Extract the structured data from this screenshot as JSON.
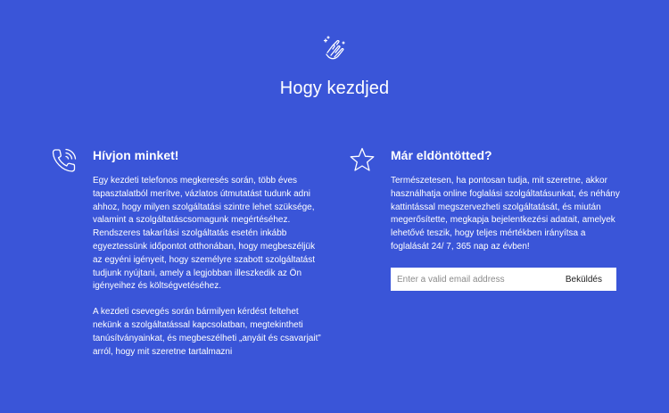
{
  "header": {
    "icon": "hand-wash-icon",
    "title": "Hogy kezdjed"
  },
  "left": {
    "icon": "phone-icon",
    "heading": "Hívjon minket!",
    "paragraphs": [
      "Egy kezdeti telefonos megkeresés során, több éves tapasztalatból merítve, vázlatos útmutatást tudunk adni ahhoz, hogy milyen szolgáltatási szintre lehet szüksége, valamint a szolgáltatáscsomagunk megértéséhez. Rendszeres takarítási szolgáltatás esetén inkább egyeztessünk időpontot otthonában, hogy megbeszéljük az egyéni igényeit, hogy személyre szabott szolgáltatást tudjunk nyújtani, amely a legjobban illeszkedik az Ön igényeihez és költségvetéséhez.",
      "A kezdeti csevegés során bármilyen kérdést feltehet nekünk a szolgáltatással kapcsolatban, megtekintheti tanúsítványainkat, és megbeszélheti „anyáit és csavarjait” arról, hogy mit szeretne tartalmazni"
    ]
  },
  "right": {
    "icon": "star-icon",
    "heading": "Már eldöntötted?",
    "paragraph": "Természetesen, ha pontosan tudja, mit szeretne, akkor használhatja online foglalási szolgáltatásunkat, és néhány kattintással megszervezheti szolgáltatását, és miután megerősítette, megkapja bejelentkezési adatait, amelyek lehetővé teszik, hogy teljes mértékben irányítsa a foglalását 24/ 7, 365 nap az évben!",
    "form": {
      "email_placeholder": "Enter a valid email address",
      "email_value": "",
      "submit_label": "Beküldés"
    }
  },
  "colors": {
    "background": "#3a55d8",
    "text": "#ffffff",
    "input_bg": "#ffffff"
  }
}
